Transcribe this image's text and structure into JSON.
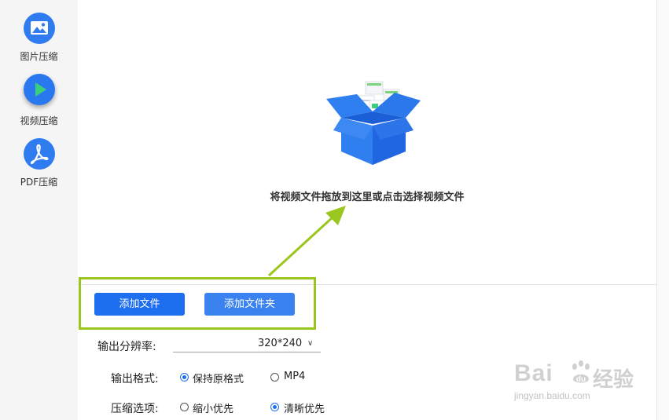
{
  "sidebar": {
    "items": [
      {
        "label": "图片压缩",
        "icon": "image-icon",
        "active": false
      },
      {
        "label": "视频压缩",
        "icon": "play-icon",
        "active": true
      },
      {
        "label": "PDF压缩",
        "icon": "pdf-icon",
        "active": false
      }
    ]
  },
  "dropzone": {
    "text": "将视频文件拖放到这里或点击选择视频文件",
    "icon": "open-box-icon"
  },
  "actions": {
    "add_file": "添加文件",
    "add_folder": "添加文件夹"
  },
  "settings": {
    "resolution": {
      "label": "输出分辨率:",
      "value": "320*240"
    },
    "format": {
      "label": "输出格式:",
      "options": [
        {
          "label": "保持原格式",
          "checked": true
        },
        {
          "label": "MP4",
          "checked": false
        }
      ]
    },
    "compression": {
      "label": "压缩选项:",
      "options": [
        {
          "label": "缩小优先",
          "checked": false
        },
        {
          "label": "清晰优先",
          "checked": true
        }
      ]
    }
  },
  "watermark": {
    "brand": "Bai",
    "brand_suffix": "du",
    "cn": "经验",
    "url": "jingyan.baidu.com"
  },
  "colors": {
    "accent": "#1e6ff0",
    "annotation": "#9bc61e",
    "sidebar_bg": "#f5f5f5"
  }
}
